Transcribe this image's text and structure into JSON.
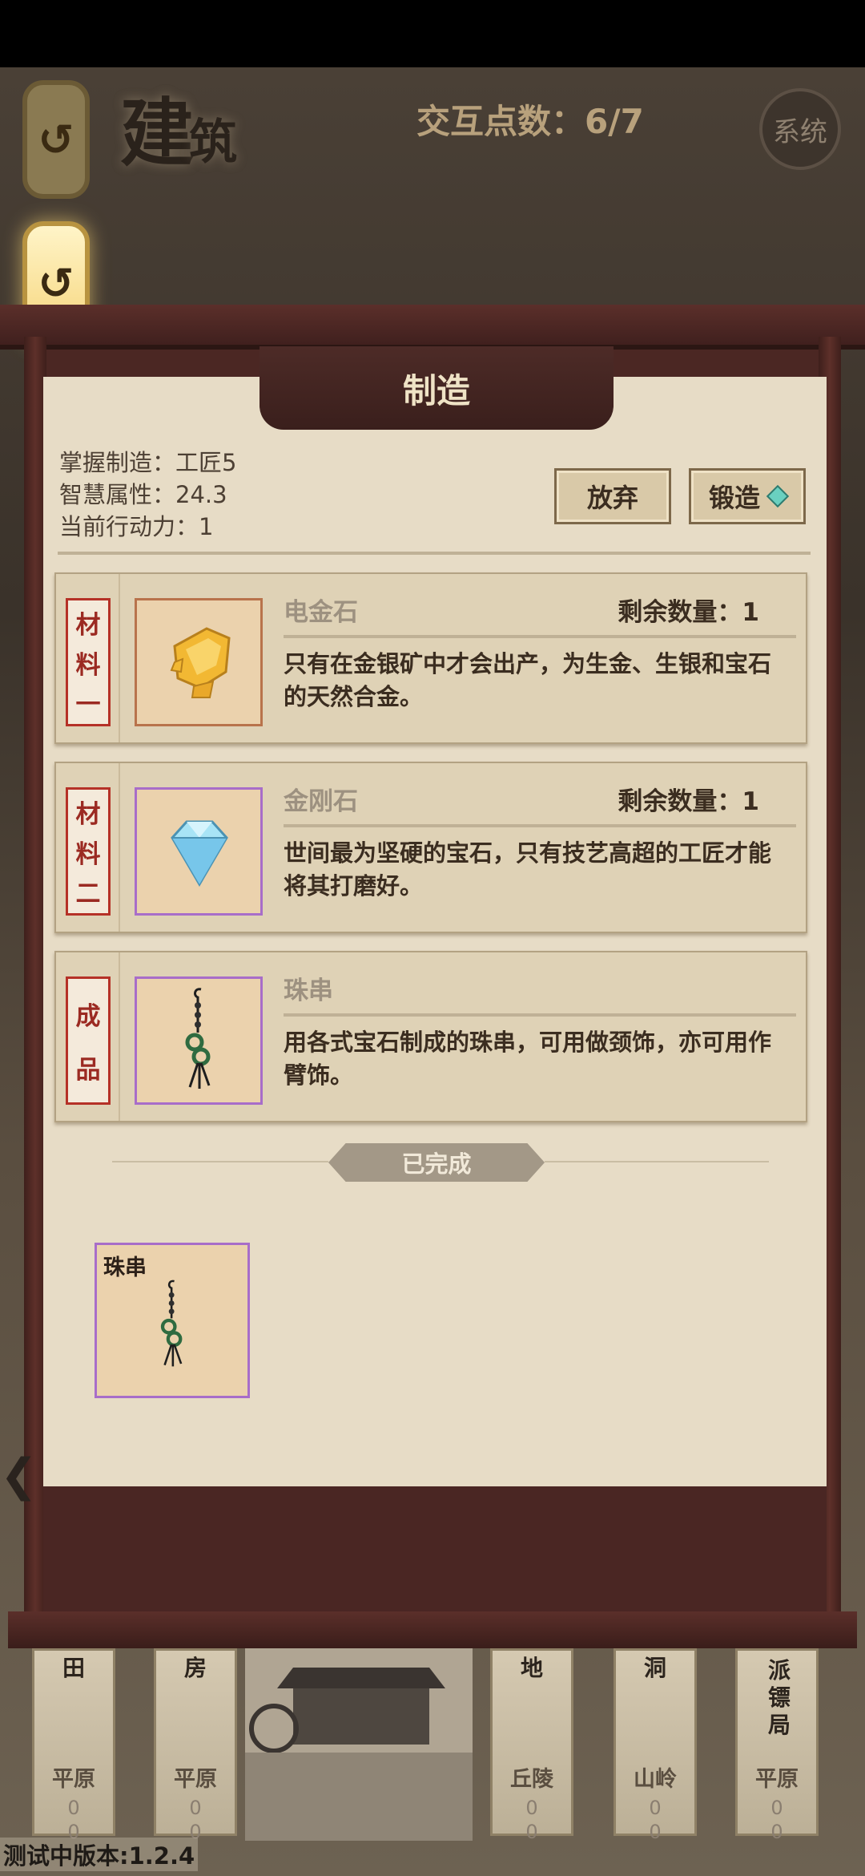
{
  "header": {
    "title_main": "建",
    "title_small": "筑",
    "interaction_points": "交互点数：6/7",
    "system_button": "系统",
    "back_icon": "↺"
  },
  "panel": {
    "title": "制造",
    "stats": [
      "掌握制造：工匠5",
      "智慧属性：24.3",
      "当前行动力：1"
    ],
    "abandon_button": "放弃",
    "forge_button": "锻造"
  },
  "cards": [
    {
      "tag": [
        "材",
        "料",
        "一"
      ],
      "name": "电金石",
      "remaining": "剩余数量：1",
      "description_line1": "只有在金银矿中才会出产，为生金、生银和宝石",
      "description_line2": "的天然合金。",
      "icon": "gold-ore-icon"
    },
    {
      "tag": [
        "材",
        "料",
        "二"
      ],
      "name": "金刚石",
      "remaining": "剩余数量：1",
      "description_line1": "世间最为坚硬的宝石，只有技艺高超的工匠才能",
      "description_line2": "将其打磨好。",
      "icon": "diamond-icon"
    },
    {
      "tag": [
        "成",
        "品"
      ],
      "name": "珠串",
      "remaining": "",
      "description_line1": "用各式宝石制成的珠串，可用做颈饰，亦可用作",
      "description_line2": "臂饰。",
      "icon": "bead-string-icon"
    }
  ],
  "completed": {
    "label": "已完成",
    "items": [
      {
        "name": "珠串",
        "icon": "bead-string-icon"
      }
    ]
  },
  "town": {
    "buildings": [
      {
        "top": "田",
        "terrain": "平原",
        "counts": [
          "0",
          "0"
        ]
      },
      {
        "top": "房",
        "terrain": "平原",
        "counts": [
          "0",
          "0"
        ]
      },
      {
        "top": "地",
        "terrain": "丘陵",
        "counts": [
          "0",
          "0"
        ]
      },
      {
        "top": "洞",
        "terrain": "山岭",
        "counts": [
          "0",
          "0"
        ]
      },
      {
        "top": "派镖局",
        "terrain": "平原",
        "counts": [
          "0",
          "0"
        ]
      }
    ]
  },
  "version": "测试中版本:1.2.4",
  "colors": {
    "accent_red": "#b53127",
    "parchment": "#e7dcc6",
    "frame": "#5b2f2a",
    "rare_purple": "#a86dc9"
  }
}
